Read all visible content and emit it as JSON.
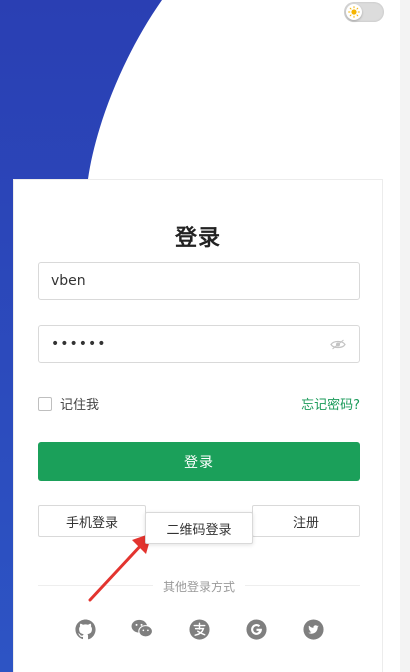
{
  "colors": {
    "background_blue": "#2a42b8",
    "primary_green": "#1ba05a",
    "link_green": "#1a9a59",
    "annotation_red": "#e3342f"
  },
  "header": {
    "theme_toggle_icon": "sun-icon"
  },
  "login": {
    "title": "登录",
    "username_value": "vben",
    "password_value": "••••••",
    "password_toggle_icon": "eye-icon",
    "remember_label": "记住我",
    "forgot_label": "忘记密码?",
    "submit_label": "登录",
    "phone_login_label": "手机登录",
    "qrcode_login_label": "二维码登录",
    "register_label": "注册",
    "other_methods_label": "其他登录方式"
  },
  "social_icons": [
    "github-icon",
    "wechat-icon",
    "alipay-icon",
    "google-icon",
    "twitter-icon"
  ]
}
